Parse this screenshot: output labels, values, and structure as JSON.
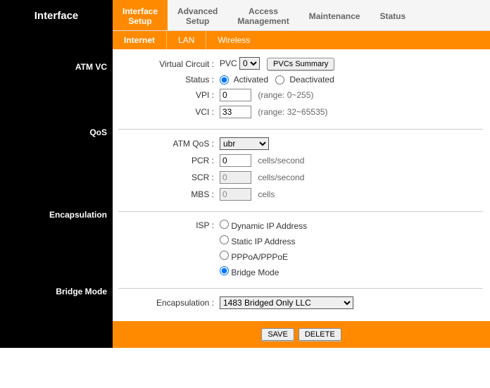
{
  "brand": "Interface",
  "tabs": [
    "Interface\nSetup",
    "Advanced\nSetup",
    "Access\nManagement",
    "Maintenance",
    "Status"
  ],
  "active_tab": 0,
  "subtabs": [
    "Internet",
    "LAN",
    "Wireless"
  ],
  "active_subtab": 0,
  "sections": {
    "atm_vc": {
      "title": "ATM VC",
      "vc_label": "Virtual Circuit",
      "vc_prefix": "PVC",
      "vc_value": "0",
      "pvcs_summary_btn": "PVCs Summary",
      "status_label": "Status",
      "status_activated": "Activated",
      "status_deactivated": "Deactivated",
      "status_value": "Activated",
      "vpi_label": "VPI",
      "vpi_value": "0",
      "vpi_range": "(range: 0~255)",
      "vci_label": "VCI",
      "vci_value": "33",
      "vci_range": "(range: 32~65535)"
    },
    "qos": {
      "title": "QoS",
      "atm_qos_label": "ATM QoS",
      "atm_qos_value": "ubr",
      "pcr_label": "PCR",
      "pcr_value": "0",
      "pcr_unit": "cells/second",
      "scr_label": "SCR",
      "scr_value": "0",
      "scr_unit": "cells/second",
      "mbs_label": "MBS",
      "mbs_value": "0",
      "mbs_unit": "cells"
    },
    "encap": {
      "title": "Encapsulation",
      "isp_label": "ISP",
      "isp_options": [
        "Dynamic IP Address",
        "Static IP Address",
        "PPPoA/PPPoE",
        "Bridge Mode"
      ],
      "isp_value": "Bridge Mode"
    },
    "bridge": {
      "title": "Bridge Mode",
      "encap_label": "Encapsulation",
      "encap_value": "1483 Bridged Only LLC"
    }
  },
  "footer": {
    "save": "SAVE",
    "delete": "DELETE"
  }
}
